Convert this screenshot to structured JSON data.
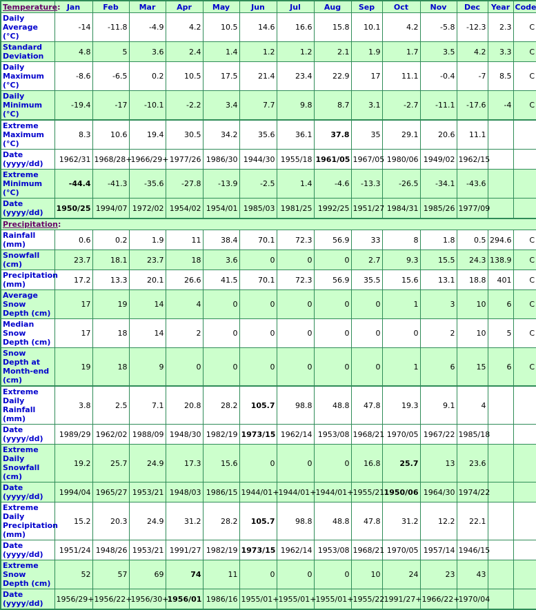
{
  "columns": [
    "Jan",
    "Feb",
    "Mar",
    "Apr",
    "May",
    "Jun",
    "Jul",
    "Aug",
    "Sep",
    "Oct",
    "Nov",
    "Dec",
    "Year",
    "Code"
  ],
  "temperature": {
    "section_label": "Temperature",
    "rows": [
      {
        "label": "Daily Average (°C)",
        "bg": "w",
        "values": [
          "-14",
          "-11.8",
          "-4.9",
          "4.2",
          "10.5",
          "14.6",
          "16.6",
          "15.8",
          "10.1",
          "4.2",
          "-5.8",
          "-12.3",
          "2.3",
          "C"
        ],
        "bold": []
      },
      {
        "label": "Standard Deviation",
        "bg": "g",
        "values": [
          "4.8",
          "5",
          "3.6",
          "2.4",
          "1.4",
          "1.2",
          "1.2",
          "2.1",
          "1.9",
          "1.7",
          "3.5",
          "4.2",
          "3.3",
          "C"
        ],
        "bold": []
      },
      {
        "label": "Daily Maximum (°C)",
        "bg": "w",
        "values": [
          "-8.6",
          "-6.5",
          "0.2",
          "10.5",
          "17.5",
          "21.4",
          "23.4",
          "22.9",
          "17",
          "11.1",
          "-0.4",
          "-7",
          "8.5",
          "C"
        ],
        "bold": []
      },
      {
        "label": "Daily Minimum (°C)",
        "bg": "g",
        "values": [
          "-19.4",
          "-17",
          "-10.1",
          "-2.2",
          "3.4",
          "7.7",
          "9.8",
          "8.7",
          "3.1",
          "-2.7",
          "-11.1",
          "-17.6",
          "-4",
          "C"
        ],
        "bold": []
      },
      {
        "label": "Extreme Maximum (°C)",
        "bg": "w",
        "sec_start": true,
        "values": [
          "8.3",
          "10.6",
          "19.4",
          "30.5",
          "34.2",
          "35.6",
          "36.1",
          "37.8",
          "35",
          "29.1",
          "20.6",
          "11.1",
          "",
          ""
        ],
        "bold": [
          7
        ]
      },
      {
        "label": "Date (yyyy/dd)",
        "bg": "w",
        "values": [
          "1962/31",
          "1968/28+",
          "1966/29+",
          "1977/26",
          "1986/30",
          "1944/30",
          "1955/18",
          "1961/05",
          "1967/05",
          "1980/06",
          "1949/02",
          "1962/15",
          "",
          ""
        ],
        "bold": [
          7
        ]
      },
      {
        "label": "Extreme Minimum (°C)",
        "bg": "g",
        "values": [
          "-44.4",
          "-41.3",
          "-35.6",
          "-27.8",
          "-13.9",
          "-2.5",
          "1.4",
          "-4.6",
          "-13.3",
          "-26.5",
          "-34.1",
          "-43.6",
          "",
          ""
        ],
        "bold": [
          0
        ]
      },
      {
        "label": "Date (yyyy/dd)",
        "bg": "g",
        "values": [
          "1950/25",
          "1994/07",
          "1972/02",
          "1954/02",
          "1954/01",
          "1985/03",
          "1981/25",
          "1992/25",
          "1951/27",
          "1984/31",
          "1985/26",
          "1977/09",
          "",
          ""
        ],
        "bold": [
          0
        ]
      }
    ]
  },
  "precipitation": {
    "section_label": "Precipitation",
    "rows": [
      {
        "label": "Rainfall (mm)",
        "bg": "w",
        "values": [
          "0.6",
          "0.2",
          "1.9",
          "11",
          "38.4",
          "70.1",
          "72.3",
          "56.9",
          "33",
          "8",
          "1.8",
          "0.5",
          "294.6",
          "C"
        ],
        "bold": []
      },
      {
        "label": "Snowfall (cm)",
        "bg": "g",
        "values": [
          "23.7",
          "18.1",
          "23.7",
          "18",
          "3.6",
          "0",
          "0",
          "0",
          "2.7",
          "9.3",
          "15.5",
          "24.3",
          "138.9",
          "C"
        ],
        "bold": []
      },
      {
        "label": "Precipitation (mm)",
        "bg": "w",
        "values": [
          "17.2",
          "13.3",
          "20.1",
          "26.6",
          "41.5",
          "70.1",
          "72.3",
          "56.9",
          "35.5",
          "15.6",
          "13.1",
          "18.8",
          "401",
          "C"
        ],
        "bold": []
      },
      {
        "label": "Average Snow Depth (cm)",
        "bg": "g",
        "values": [
          "17",
          "19",
          "14",
          "4",
          "0",
          "0",
          "0",
          "0",
          "0",
          "1",
          "3",
          "10",
          "6",
          "C"
        ],
        "bold": []
      },
      {
        "label": "Median Snow Depth (cm)",
        "bg": "w",
        "values": [
          "17",
          "18",
          "14",
          "2",
          "0",
          "0",
          "0",
          "0",
          "0",
          "0",
          "2",
          "10",
          "5",
          "C"
        ],
        "bold": []
      },
      {
        "label": "Snow Depth at Month-end (cm)",
        "bg": "g",
        "values": [
          "19",
          "18",
          "9",
          "0",
          "0",
          "0",
          "0",
          "0",
          "0",
          "1",
          "6",
          "15",
          "6",
          "C"
        ],
        "bold": []
      },
      {
        "label": "Extreme Daily Rainfall (mm)",
        "bg": "w",
        "sec_start": true,
        "values": [
          "3.8",
          "2.5",
          "7.1",
          "20.8",
          "28.2",
          "105.7",
          "98.8",
          "48.8",
          "47.8",
          "19.3",
          "9.1",
          "4",
          "",
          ""
        ],
        "bold": [
          5
        ]
      },
      {
        "label": "Date (yyyy/dd)",
        "bg": "w",
        "values": [
          "1989/29",
          "1962/02",
          "1988/09",
          "1948/30",
          "1982/19",
          "1973/15",
          "1962/14",
          "1953/08",
          "1968/21",
          "1970/05",
          "1967/22",
          "1985/18",
          "",
          ""
        ],
        "bold": [
          5
        ]
      },
      {
        "label": "Extreme Daily Snowfall (cm)",
        "bg": "g",
        "values": [
          "19.2",
          "25.7",
          "24.9",
          "17.3",
          "15.6",
          "0",
          "0",
          "0",
          "16.8",
          "25.7",
          "13",
          "23.6",
          "",
          ""
        ],
        "bold": [
          9
        ]
      },
      {
        "label": "Date (yyyy/dd)",
        "bg": "g",
        "values": [
          "1994/04",
          "1965/27",
          "1953/21",
          "1948/03",
          "1986/15",
          "1944/01+",
          "1944/01+",
          "1944/01+",
          "1955/21",
          "1950/06",
          "1964/30",
          "1974/22",
          "",
          ""
        ],
        "bold": [
          9
        ]
      },
      {
        "label": "Extreme Daily Precipitation (mm)",
        "bg": "w",
        "values": [
          "15.2",
          "20.3",
          "24.9",
          "31.2",
          "28.2",
          "105.7",
          "98.8",
          "48.8",
          "47.8",
          "31.2",
          "12.2",
          "22.1",
          "",
          ""
        ],
        "bold": [
          5
        ]
      },
      {
        "label": "Date (yyyy/dd)",
        "bg": "w",
        "values": [
          "1951/24",
          "1948/26",
          "1953/21",
          "1991/27",
          "1982/19",
          "1973/15",
          "1962/14",
          "1953/08",
          "1968/21",
          "1970/05",
          "1957/14",
          "1946/15",
          "",
          ""
        ],
        "bold": [
          5
        ]
      },
      {
        "label": "Extreme Snow Depth (cm)",
        "bg": "g",
        "values": [
          "52",
          "57",
          "69",
          "74",
          "11",
          "0",
          "0",
          "0",
          "10",
          "24",
          "23",
          "43",
          "",
          ""
        ],
        "bold": [
          3
        ]
      },
      {
        "label": "Date (yyyy/dd)",
        "bg": "g",
        "values": [
          "1956/29+",
          "1956/22+",
          "1956/30+",
          "1956/01",
          "1986/16",
          "1955/01+",
          "1955/01+",
          "1955/01+",
          "1955/22",
          "1991/27+",
          "1966/22+",
          "1970/04",
          "",
          ""
        ],
        "bold": [
          3
        ]
      }
    ]
  }
}
